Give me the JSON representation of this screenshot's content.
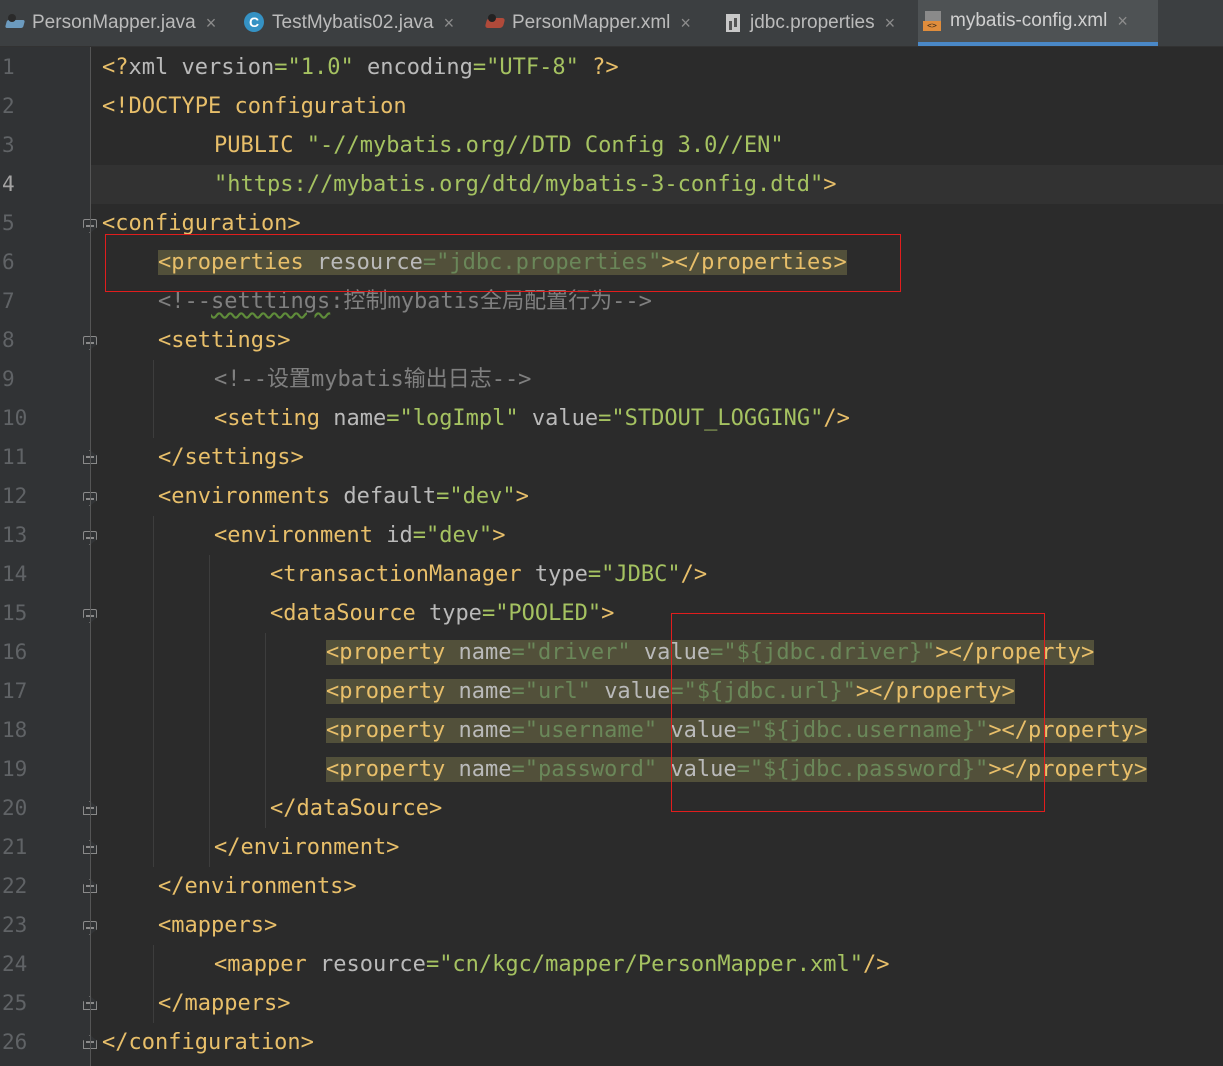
{
  "tabs": [
    {
      "label": "PersonMapper.java",
      "icon": "java-class-icon"
    },
    {
      "label": "TestMybatis02.java",
      "icon": "test-class-icon"
    },
    {
      "label": "PersonMapper.xml",
      "icon": "mapper-xml-icon"
    },
    {
      "label": "jdbc.properties",
      "icon": "properties-file-icon"
    },
    {
      "label": "mybatis-config.xml",
      "icon": "config-xml-icon",
      "active": true
    }
  ],
  "close_glyph": "×",
  "current_line": 4,
  "line_numbers": [
    "1",
    "2",
    "3",
    "4",
    "5",
    "6",
    "7",
    "8",
    "9",
    "10",
    "11",
    "12",
    "13",
    "14",
    "15",
    "16",
    "17",
    "18",
    "19",
    "20",
    "21",
    "22",
    "23",
    "24",
    "25",
    "26"
  ],
  "code": {
    "l1": {
      "open": "<?",
      "tag": "xml",
      "sp1": " ",
      "a1": "version",
      "eq": "=",
      "v1": "\"1.0\"",
      "sp2": " ",
      "a2": "encoding",
      "v2": "\"UTF-8\"",
      "sp3": " ",
      "close": "?>"
    },
    "l2": {
      "text": "<!DOCTYPE configuration"
    },
    "l3": {
      "kw": "PUBLIC",
      "sp": " ",
      "str": "\"-//mybatis.org//DTD Config 3.0//EN\""
    },
    "l4": {
      "str": "\"https://mybatis.org/dtd/mybatis-3-config.dtd\"",
      "close": ">"
    },
    "l5": {
      "text": "<configuration>"
    },
    "l6": {
      "tag": "<properties",
      "attr": " resource",
      "eq": "=",
      "val": "\"jdbc.properties\"",
      "end": "></properties>"
    },
    "l7": {
      "open": "<!--",
      "word": "setttings",
      "rest": ":控制mybatis全局配置行为-->"
    },
    "l8": {
      "text": "<settings>"
    },
    "l9": {
      "text": "<!--设置mybatis输出日志-->"
    },
    "l10": {
      "tag": "<setting",
      "a1": " name",
      "eq": "=",
      "v1": "\"logImpl\"",
      "a2": " value",
      "v2": "\"STDOUT_LOGGING\"",
      "end": "/>"
    },
    "l11": {
      "text": "</settings>"
    },
    "l12": {
      "tag": "<environments",
      "a1": " default",
      "eq": "=",
      "v1": "\"dev\"",
      "end": ">"
    },
    "l13": {
      "tag": "<environment",
      "a1": " id",
      "eq": "=",
      "v1": "\"dev\"",
      "end": ">"
    },
    "l14": {
      "tag": "<transactionManager",
      "a1": " type",
      "eq": "=",
      "v1": "\"JDBC\"",
      "end": "/>"
    },
    "l15": {
      "tag": "<dataSource",
      "a1": " type",
      "eq": "=",
      "v1": "\"POOLED\"",
      "end": ">"
    },
    "props": [
      {
        "tag": "<property",
        "a1": " name",
        "eq": "=",
        "v1": "\"driver\"",
        "gap": " ",
        "a2": "value",
        "v2": "\"${jdbc.driver}\"",
        "end": "></property>"
      },
      {
        "tag": "<property",
        "a1": " name",
        "eq": "=",
        "v1": "\"url\"",
        "gap": " ",
        "a2": "value",
        "v2": "\"${jdbc.url}\"",
        "end": "></property>"
      },
      {
        "tag": "<property",
        "a1": " name",
        "eq": "=",
        "v1": "\"username\"",
        "gap": " ",
        "a2": "value",
        "v2": "\"${jdbc.username}\"",
        "end": "></property>"
      },
      {
        "tag": "<property",
        "a1": " name",
        "eq": "=",
        "v1": "\"password\"",
        "gap": " ",
        "a2": "value",
        "v2": "\"${jdbc.password}\"",
        "end": "></property>"
      }
    ],
    "l20": {
      "text": "</dataSource>"
    },
    "l21": {
      "text": "</environment>"
    },
    "l22": {
      "text": "</environments>"
    },
    "l23": {
      "text": "<mappers>"
    },
    "l24": {
      "tag": "<mapper",
      "a1": " resource",
      "eq": "=",
      "v1": "\"cn/kgc/mapper/PersonMapper.xml\"",
      "end": "/>"
    },
    "l25": {
      "text": "</mappers>"
    },
    "l26": {
      "text": "</configuration>"
    }
  }
}
